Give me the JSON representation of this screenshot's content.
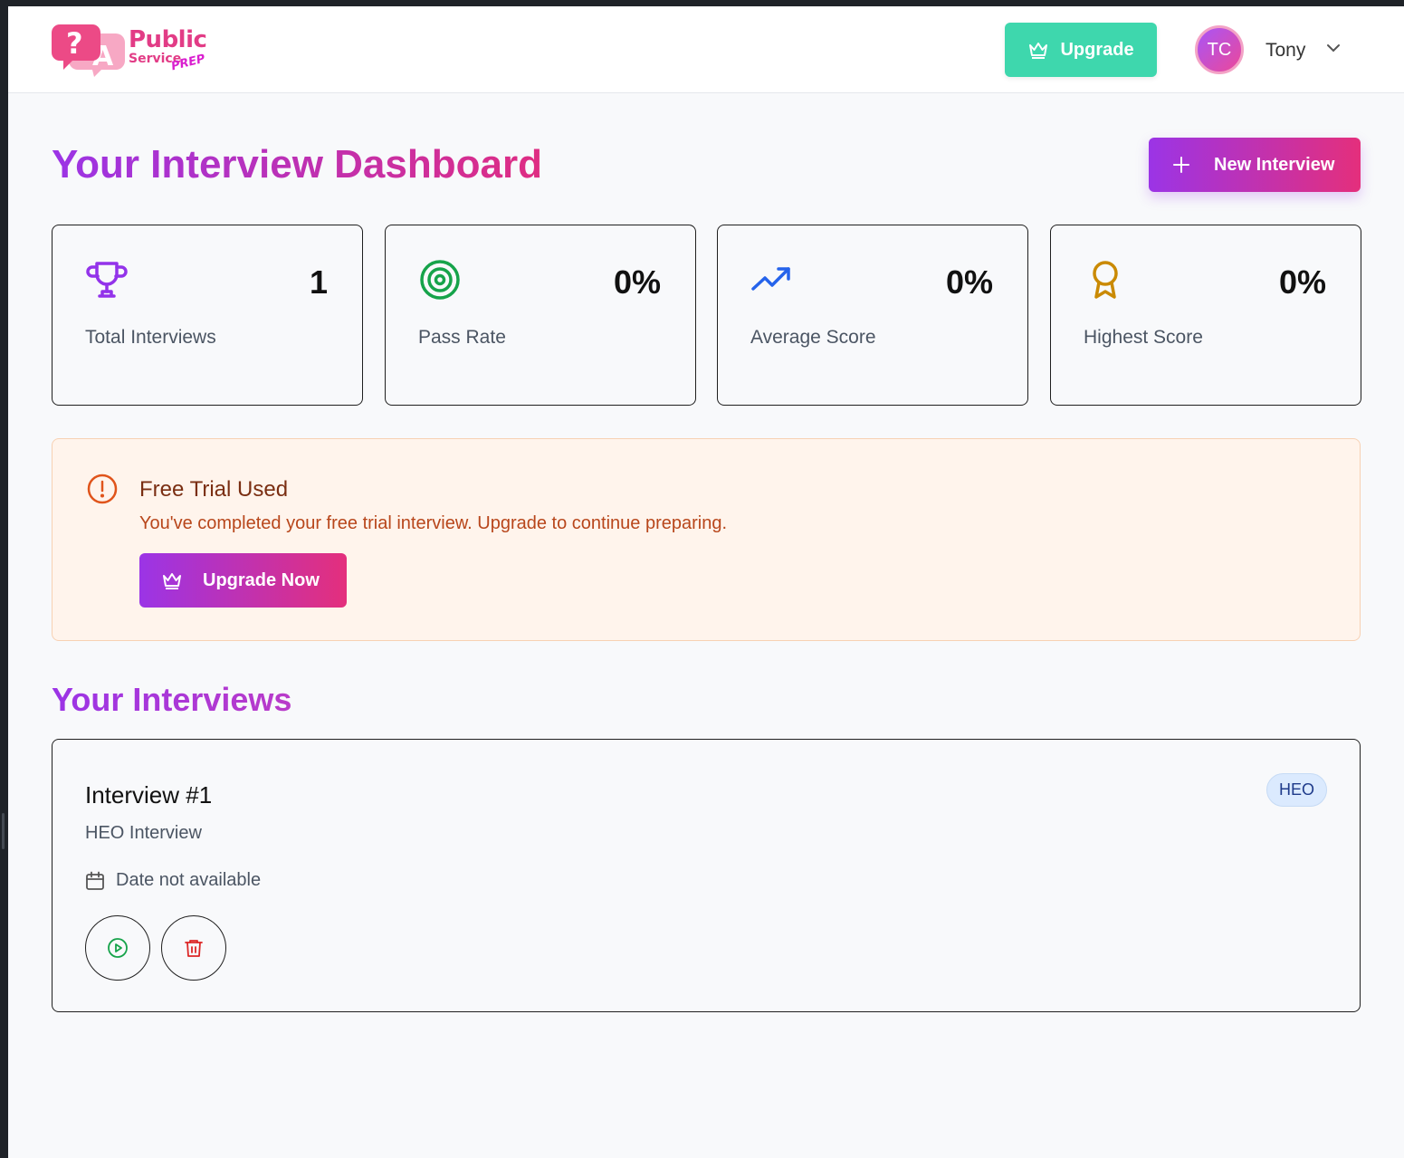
{
  "header": {
    "logo": {
      "word1": "Public",
      "word2": "Service",
      "word3": "PREP"
    },
    "upgrade_label": "Upgrade",
    "user": {
      "initials": "TC",
      "name": "Tony"
    }
  },
  "main": {
    "title": "Your Interview Dashboard",
    "new_interview_label": "New Interview",
    "stats": [
      {
        "icon": "trophy-icon",
        "value": "1",
        "label": "Total Interviews",
        "color": "#9333ea"
      },
      {
        "icon": "target-icon",
        "value": "0%",
        "label": "Pass Rate",
        "color": "#16a34a"
      },
      {
        "icon": "trending-up-icon",
        "value": "0%",
        "label": "Average Score",
        "color": "#2563eb"
      },
      {
        "icon": "award-icon",
        "value": "0%",
        "label": "Highest Score",
        "color": "#ca8a04"
      }
    ],
    "trial": {
      "title": "Free Trial Used",
      "message": "You've completed your free trial interview. Upgrade to continue preparing.",
      "button_label": "Upgrade Now"
    },
    "interviews_title": "Your Interviews",
    "interviews": [
      {
        "title": "Interview #1",
        "subtitle": "HEO Interview",
        "date": "Date not available",
        "badge": "HEO"
      }
    ]
  },
  "colors": {
    "brand_gradient_start": "#9b34e6",
    "brand_gradient_end": "#e42f7c",
    "upgrade_green": "#3ed7ad",
    "play_green": "#16a34a",
    "delete_red": "#dc2626"
  }
}
